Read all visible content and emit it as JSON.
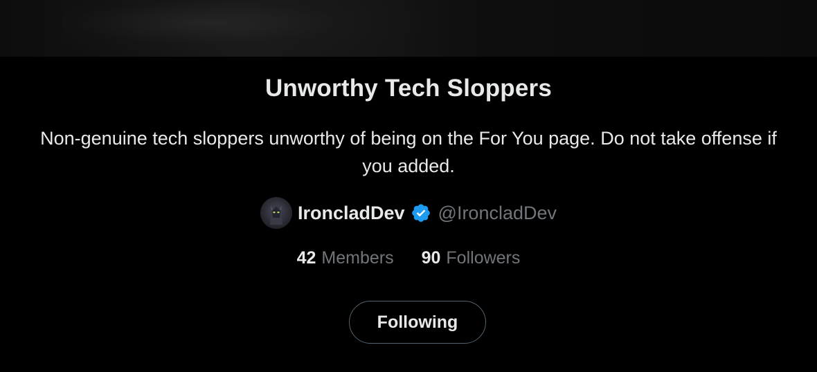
{
  "list": {
    "title": "Unworthy Tech Sloppers",
    "description": "Non-genuine tech sloppers unworthy of being on the For You page. Do not take offense if you added."
  },
  "owner": {
    "name": "IroncladDev",
    "handle": "@IroncladDev",
    "avatar_icon": "robot-avatar-icon",
    "verified_icon": "verified-badge-icon",
    "verified_color": "#1d9bf0"
  },
  "stats": {
    "members_count": "42",
    "members_label": "Members",
    "followers_count": "90",
    "followers_label": "Followers"
  },
  "actions": {
    "follow_label": "Following"
  },
  "colors": {
    "background": "#000000",
    "primary_text": "#e7e9ea",
    "secondary_text": "#71767b",
    "button_border": "#536471"
  }
}
